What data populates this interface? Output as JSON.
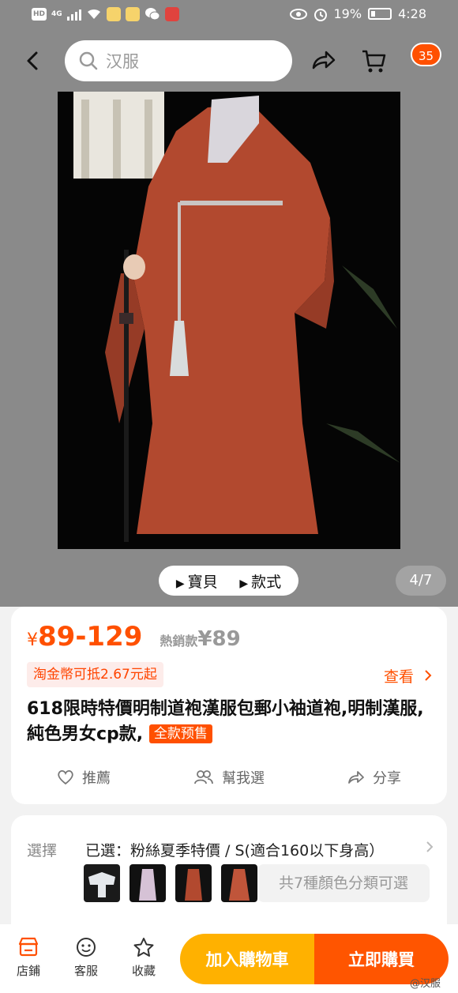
{
  "status_bar": {
    "hd": "HD",
    "network": "4G",
    "battery": "19%",
    "time": "4:28"
  },
  "header": {
    "search_placeholder": "汉服",
    "cart_count": "35",
    "icons": [
      "back-icon",
      "search-icon",
      "share-icon",
      "cart-icon"
    ]
  },
  "gallery": {
    "tab_item": "寶貝",
    "tab_style": "款式",
    "counter": "4/7"
  },
  "product": {
    "price_currency": "¥",
    "price_range": "89-129",
    "hot_label": "熱銷款",
    "hot_price": "¥89",
    "coin_offer": "淘金幣可抵2.67元起",
    "view_more": "查看",
    "title": "618限時特價明制道袍漢服包郵小袖道袍,明制漢服,純色男女cp款,",
    "presale_badge": "全款预售",
    "actions": [
      {
        "icon": "heart-icon",
        "label": "推薦"
      },
      {
        "icon": "people-icon",
        "label": "幫我選"
      },
      {
        "icon": "share-icon",
        "label": "分享"
      }
    ],
    "accent_color": "#ff5000"
  },
  "selection": {
    "label": "選擇",
    "value": "已選：粉絲夏季特價 / S(適合160以下身高）",
    "more_colors": "共7種顏色分類可選"
  },
  "bottom_bar": {
    "shop": "店鋪",
    "service": "客服",
    "favorite": "收藏",
    "add_to_cart": "加入購物車",
    "buy_now": "立即購買",
    "watermark": "@汉服"
  }
}
